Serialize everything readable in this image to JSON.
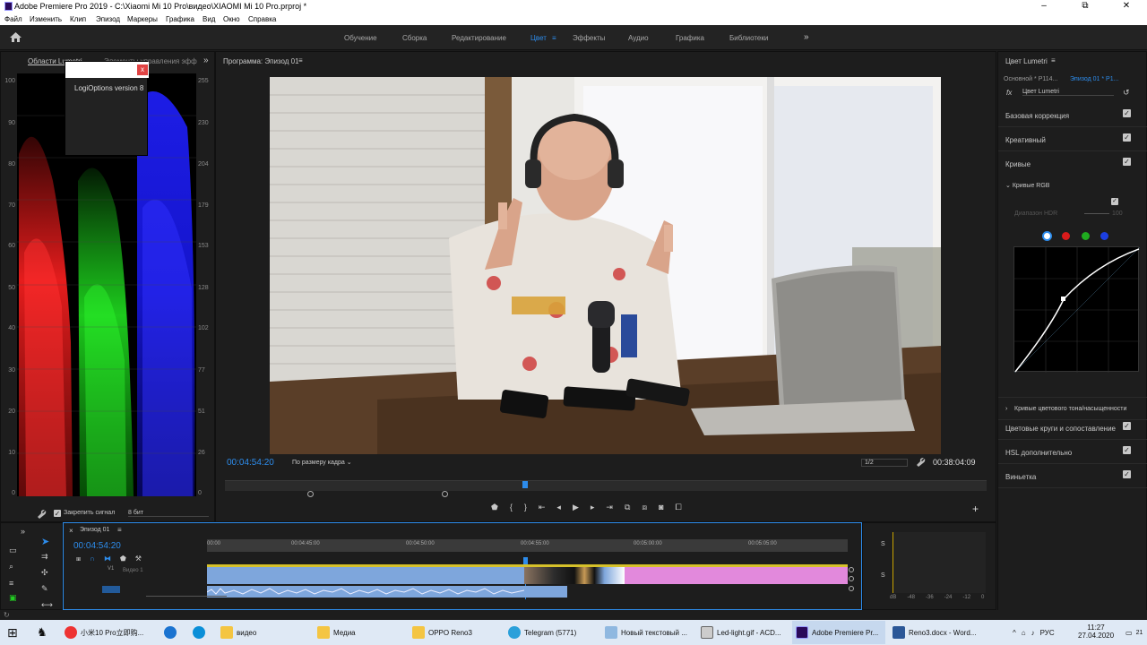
{
  "window": {
    "title": "Adobe Premiere Pro 2019 - C:\\Xiaomi Mi 10 Pro\\видео\\XIAOMI Mi 10 Pro.prproj *",
    "minimize": "–",
    "maximize": "⧉",
    "close": "✕"
  },
  "menu": [
    "Файл",
    "Изменить",
    "Клип",
    "Эпизод",
    "Маркеры",
    "Графика",
    "Вид",
    "Окно",
    "Справка"
  ],
  "workspaces": [
    "Обучение",
    "Сборка",
    "Редактирование",
    "Цвет",
    "Эффекты",
    "Аудио",
    "Графика",
    "Библиотеки"
  ],
  "workspace_active": "Цвет",
  "workspace_more": "»",
  "scopes": {
    "tab1": "Области Lumetri",
    "tab2": "Элементы управления эфф",
    "more": "»",
    "left_labels": [
      "100",
      "90",
      "80",
      "70",
      "60",
      "50",
      "40",
      "30",
      "20",
      "10",
      "0"
    ],
    "right_labels": [
      "255",
      "230",
      "204",
      "179",
      "153",
      "128",
      "102",
      "77",
      "51",
      "26",
      "0"
    ],
    "clamp": "Закрепить сигнал",
    "bits": "8 бит"
  },
  "popup": {
    "text": "LogiOptions version 8",
    "close": "x"
  },
  "program": {
    "title": "Программа: Эпизод 01",
    "timecode": "00:04:54:20",
    "fit": "По размеру кадра",
    "res": "1/2",
    "duration": "00:38:04:09",
    "add": "+"
  },
  "lumetri": {
    "title": "Цвет Lumetri",
    "master": "Основной * P114...",
    "seq": "Эпизод 01 * P1...",
    "fx": "fx",
    "effect": "Цвет Lumetri",
    "sections": [
      {
        "label": "Базовая коррекция",
        "checked": true
      },
      {
        "label": "Креативный",
        "checked": true
      },
      {
        "label": "Кривые",
        "checked": true
      }
    ],
    "rgb_curves": "Кривые RGB",
    "hdr": "Диапазон HDR",
    "hdr_val": "100",
    "curve_colors": [
      "#ffffff",
      "#d81b1b",
      "#1faa1f",
      "#1c3fe0"
    ],
    "sections2": [
      {
        "label": "Кривые цветового тона/насыщенности",
        "checked": false
      },
      {
        "label": "Цветовые круги и сопоставление",
        "checked": true
      },
      {
        "label": "HSL дополнительно",
        "checked": true
      },
      {
        "label": "Виньетка",
        "checked": true
      }
    ]
  },
  "timeline": {
    "tab": "Эпизод 01",
    "timecode": "00:04:54:20",
    "ruler": [
      "00:00",
      "00:04:45:00",
      "00:04:50:00",
      "00:04:55:00",
      "00:05:00:00",
      "00:05:05:00"
    ],
    "track_v1": "V1",
    "track_name": "Видео 1"
  },
  "audio_meter": {
    "labels": [
      "dB",
      "-48",
      "-36",
      "-24",
      "-12",
      "0"
    ],
    "s1": "S",
    "s2": "S"
  },
  "taskbar": {
    "items": [
      "小米10 Pro立即购...",
      "",
      "",
      "видео",
      "Медиа",
      "OPPO Reno3",
      "Telegram (5771)",
      "Новый текстовый ...",
      "Led-light.gif - ACD...",
      "Adobe Premiere Pr...",
      "Reno3.docx - Word..."
    ],
    "lang": "РУС",
    "time": "11:27",
    "date": "27.04.2020",
    "badge": "21"
  }
}
